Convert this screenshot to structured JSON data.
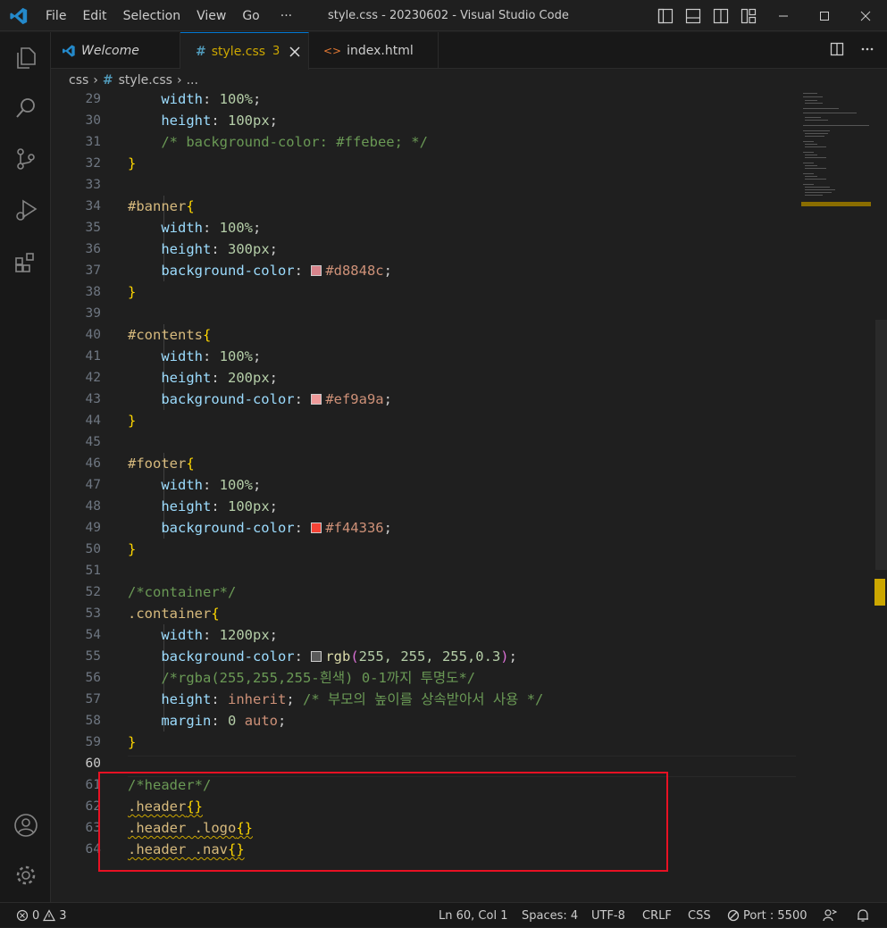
{
  "window": {
    "title": "style.css - 20230602 - Visual Studio Code",
    "menu": [
      "File",
      "Edit",
      "Selection",
      "View",
      "Go",
      "···"
    ]
  },
  "tabs": [
    {
      "label": "Welcome",
      "icon": "vscode-icon",
      "active": false
    },
    {
      "label": "style.css",
      "badge": "3",
      "icon": "hash-icon",
      "active": true
    },
    {
      "label": "index.html",
      "icon": "html-icon",
      "active": false
    }
  ],
  "breadcrumb": {
    "folder": "css",
    "file": "style.css",
    "more": "..."
  },
  "editor": {
    "current_line": 60,
    "line_numbers": [
      "29",
      "30",
      "31",
      "32",
      "33",
      "34",
      "35",
      "36",
      "37",
      "38",
      "39",
      "40",
      "41",
      "42",
      "43",
      "44",
      "45",
      "46",
      "47",
      "48",
      "49",
      "50",
      "51",
      "52",
      "53",
      "54",
      "55",
      "56",
      "57",
      "58",
      "59",
      "60",
      "61",
      "62",
      "63",
      "64"
    ],
    "code": {
      "l29": {
        "prop": "width",
        "num": "100%"
      },
      "l30": {
        "prop": "height",
        "num": "100px"
      },
      "l31": {
        "comment": "/* background-color: #ffebee; */"
      },
      "l34": {
        "selector": "#banner"
      },
      "l35": {
        "prop": "width",
        "num": "100%"
      },
      "l36": {
        "prop": "height",
        "num": "300px"
      },
      "l37": {
        "prop": "background-color",
        "value": "#d8848c",
        "swatch": "#d8848c"
      },
      "l40": {
        "selector": "#contents"
      },
      "l41": {
        "prop": "width",
        "num": "100%"
      },
      "l42": {
        "prop": "height",
        "num": "200px"
      },
      "l43": {
        "prop": "background-color",
        "value": "#ef9a9a",
        "swatch": "#ef9a9a"
      },
      "l46": {
        "selector": "#footer"
      },
      "l47": {
        "prop": "width",
        "num": "100%"
      },
      "l48": {
        "prop": "height",
        "num": "100px"
      },
      "l49": {
        "prop": "background-color",
        "value": "#f44336",
        "swatch": "#f44336"
      },
      "l52": {
        "comment": "/*container*/"
      },
      "l53": {
        "selector": ".container"
      },
      "l54": {
        "prop": "width",
        "num": "1200px"
      },
      "l55": {
        "prop": "background-color",
        "fn": "rgb",
        "args": "255, 255, 255,0.3",
        "swatch": "#5a5a5a"
      },
      "l56": {
        "comment": "/*rgba(255,255,255-흰색) 0-1까지 투명도*/"
      },
      "l57": {
        "prop": "height",
        "value": "inherit",
        "comment": "/* 부모의 높이를 상속받아서 사용 */"
      },
      "l58": {
        "prop": "margin",
        "num": "0",
        "value": "auto"
      },
      "l61": {
        "comment": "/*header*/"
      },
      "l62": {
        "selector": ".header"
      },
      "l63": {
        "selector": ".header .logo"
      },
      "l64": {
        "selector": ".header .nav"
      }
    }
  },
  "status": {
    "errors": "0",
    "warnings": "3",
    "position": "Ln 60, Col 1",
    "spaces": "Spaces: 4",
    "encoding": "UTF-8",
    "eol": "CRLF",
    "language": "CSS",
    "port": "Port : 5500"
  },
  "colors": {
    "accent": "#0078d4",
    "highlight_box": "#e81123",
    "tab_modified": "#cca700"
  }
}
